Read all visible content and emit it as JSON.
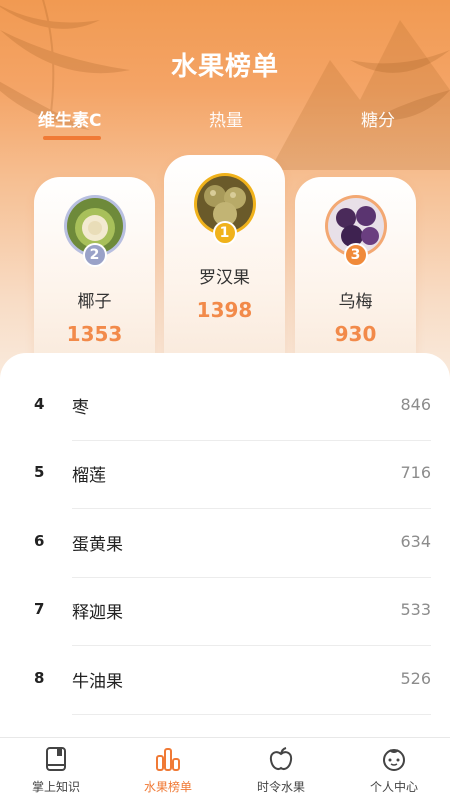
{
  "header": {
    "title": "水果榜单"
  },
  "tabs": [
    {
      "label": "维生素C",
      "active": true
    },
    {
      "label": "热量",
      "active": false
    },
    {
      "label": "糖分",
      "active": false
    }
  ],
  "podium": [
    {
      "rank": "1",
      "name": "罗汉果",
      "value": "1398",
      "medal_color": "#f0b21b"
    },
    {
      "rank": "2",
      "name": "椰子",
      "value": "1353",
      "medal_color": "#9aa2c8"
    },
    {
      "rank": "3",
      "name": "乌梅",
      "value": "930",
      "medal_color": "#f08a3a"
    }
  ],
  "list": [
    {
      "rank": "4",
      "name": "枣",
      "value": "846"
    },
    {
      "rank": "5",
      "name": "榴莲",
      "value": "716"
    },
    {
      "rank": "6",
      "name": "蛋黄果",
      "value": "634"
    },
    {
      "rank": "7",
      "name": "释迦果",
      "value": "533"
    },
    {
      "rank": "8",
      "name": "牛油果",
      "value": "526"
    }
  ],
  "tabbar": [
    {
      "label": "掌上知识",
      "icon": "book-icon",
      "active": false
    },
    {
      "label": "水果榜单",
      "icon": "chart-icon",
      "active": true
    },
    {
      "label": "时令水果",
      "icon": "apple-icon",
      "active": false
    },
    {
      "label": "个人中心",
      "icon": "face-icon",
      "active": false
    }
  ],
  "colors": {
    "accent": "#f07a36",
    "value_orange": "#f28a4a",
    "header_orange": "#f19a52"
  }
}
